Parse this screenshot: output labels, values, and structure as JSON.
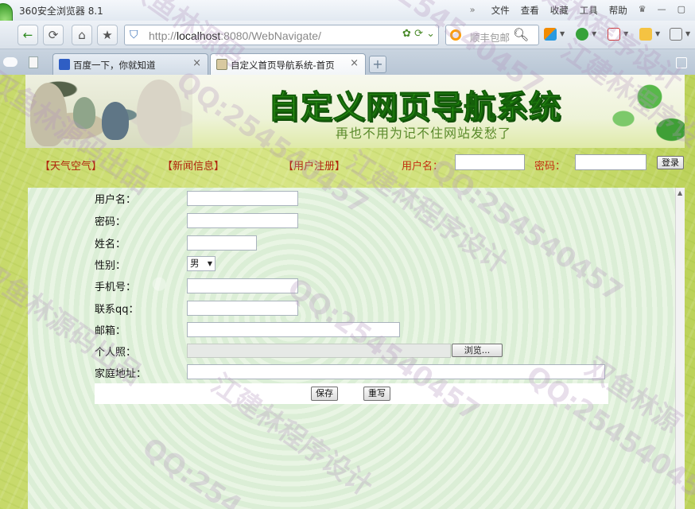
{
  "browser": {
    "app_title": "360安全浏览器 8.1",
    "menu": [
      "文件",
      "查看",
      "收藏",
      "工具",
      "帮助"
    ],
    "url_scheme": "http://",
    "url_host": "localhost",
    "url_rest": ":8080/WebNavigate/",
    "search_placeholder": "顺丰包邮",
    "tabs": [
      {
        "label": "百度一下，你就知道",
        "close": "×"
      },
      {
        "label": "自定义首页导航系统-首页",
        "close": "×"
      }
    ],
    "new_tab": "+"
  },
  "banner": {
    "title": "自定义网页导航系统",
    "subtitle": "再也不用为记不住网站发愁了"
  },
  "topnav": {
    "links": [
      "【天气空气】",
      "【新闻信息】",
      "【用户注册】"
    ],
    "username_label": "用户名：",
    "password_label": "密码：",
    "login_button": "登录"
  },
  "form": {
    "labels": [
      "用户名：",
      "密码：",
      "姓名：",
      "性别：",
      "手机号：",
      "联系qq：",
      "邮箱：",
      "个人照：",
      "家庭地址："
    ],
    "gender_value": "男",
    "browse_button": "浏览...",
    "save_button": "保存",
    "reset_button": "重写"
  },
  "watermarks": [
    "双鱼林源码",
    "QQ:254540457",
    "江建林程序设计",
    "双鱼林源码出品",
    "QQ:254540457",
    "江建林程序设计",
    "QQ:254540457",
    "双鱼林源码出品",
    "QQ:254540457",
    "江建林程序设计",
    "QQ:254540457",
    "双鱼林源",
    "QQ:254",
    "江建林程序设计"
  ]
}
